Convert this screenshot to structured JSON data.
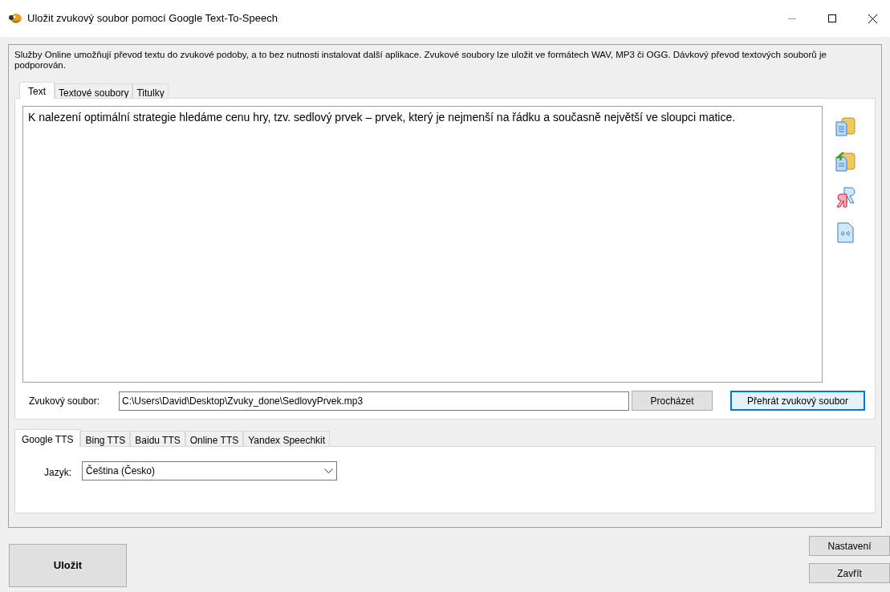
{
  "window": {
    "title": "Uložit zvukový soubor pomocí Google Text-To-Speech"
  },
  "description": "Služby Online umožňují převod textu do zvukové podoby, a to bez nutnosti instalovat další aplikace. Zvukové soubory lze uložit ve formátech WAV, MP3 či OGG. Dávkový převod textových souborů je podporován.",
  "tabs": [
    {
      "label": "Text",
      "selected": true
    },
    {
      "label": "Textové soubory",
      "selected": false
    },
    {
      "label": "Titulky",
      "selected": false
    }
  ],
  "text": "K nalezení optimální strategie hledáme cenu hry, tzv. sedlový prvek – prvek, který je nejmenší na řádku a současně největší ve sloupci matice.",
  "sound_file": {
    "label": "Zvukový soubor:",
    "value": "C:\\Users\\David\\Desktop\\Zvuky_done\\SedlovyPrvek.mp3"
  },
  "file_buttons": [
    {
      "label": "Procházet",
      "focused": false
    },
    {
      "label": "Přehrát zvukový soubor",
      "focused": true
    }
  ],
  "engine_tabs": [
    {
      "label": "Google TTS",
      "selected": true
    },
    {
      "label": "Bing TTS",
      "selected": false
    },
    {
      "label": "Baidu TTS",
      "selected": false
    },
    {
      "label": "Online TTS",
      "selected": false
    },
    {
      "label": "Yandex Speechkit",
      "selected": false
    }
  ],
  "language": {
    "label": "Jazyk:",
    "value": "Čeština (Česko)"
  },
  "save_button": "Uložit",
  "side_buttons": [
    "Nastavení",
    "Zavřít"
  ]
}
